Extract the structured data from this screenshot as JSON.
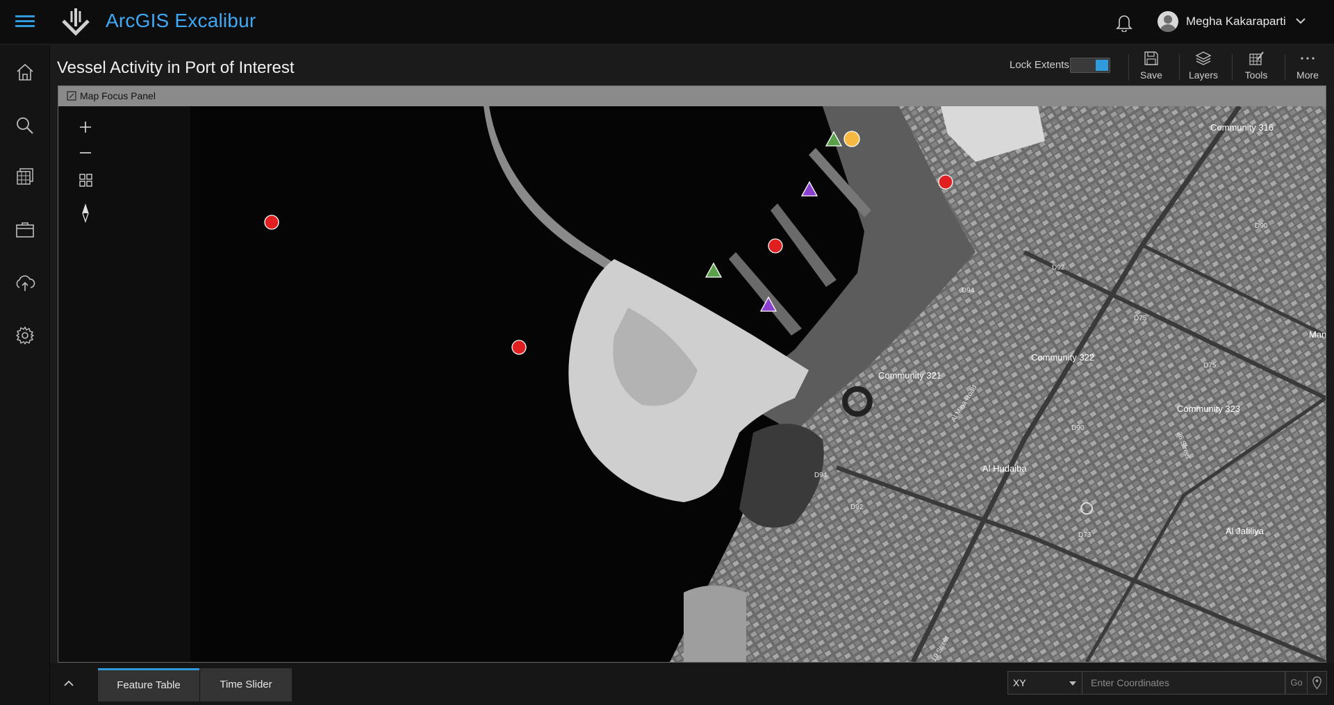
{
  "app": {
    "title": "ArcGIS Excalibur",
    "user": "Megha Kakaraparti"
  },
  "page": {
    "title": "Vessel Activity in Port of Interest",
    "lock_extents_label": "Lock Extents",
    "lock_extents_on": true
  },
  "toolbar": {
    "save_label": "Save",
    "layers_label": "Layers",
    "tools_label": "Tools",
    "more_label": "More"
  },
  "sidebar": {
    "items": [
      {
        "icon": "home-icon"
      },
      {
        "icon": "search-icon"
      },
      {
        "icon": "image-stack-icon"
      },
      {
        "icon": "briefcase-icon"
      },
      {
        "icon": "upload-cloud-icon"
      },
      {
        "icon": "gear-icon"
      }
    ]
  },
  "map": {
    "panel_title": "Map Focus Panel",
    "labels": {
      "community_316": "Community 316",
      "community_321": "Community 321",
      "community_322": "Community 322",
      "community_323": "Community 323",
      "al_hudaiba": "Al Hudaiba",
      "al_jafiliya": "Al Jafiliya",
      "mankhool": "Mankhoo",
      "al_mina_road": "Al Mina Road",
      "road_26": "26 Street",
      "road_19": "19 Street",
      "d90_a": "D90",
      "d90_b": "D90",
      "d92_a": "D92",
      "d92_b": "D92",
      "d94_a": "D94",
      "d94_b": "D94",
      "d75_a": "D75",
      "d75_b": "D75",
      "d73": "D73"
    },
    "markers": [
      {
        "type": "red-circle",
        "color": "#e02020"
      },
      {
        "type": "orange-circle",
        "color": "#f5b942"
      },
      {
        "type": "green-triangle",
        "color": "#5aa04a"
      },
      {
        "type": "purple-triangle",
        "color": "#8a3fd1"
      }
    ]
  },
  "bottom": {
    "tabs": [
      "Feature Table",
      "Time Slider"
    ],
    "coord_type": "XY",
    "coord_placeholder": "Enter Coordinates",
    "go_label": "Go"
  }
}
